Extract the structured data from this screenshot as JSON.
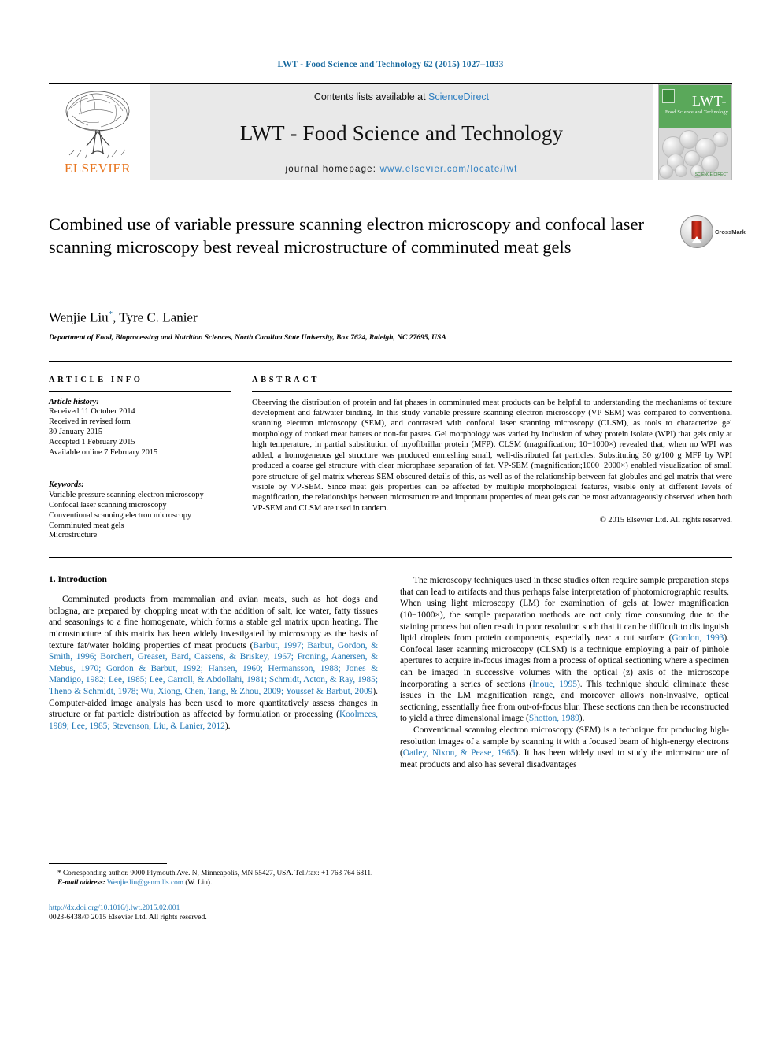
{
  "running_head": "LWT - Food Science and Technology 62 (2015) 1027–1033",
  "masthead": {
    "publisher": "ELSEVIER",
    "contents_prefix": "Contents lists available at ",
    "contents_link": "ScienceDirect",
    "journal_name": "LWT - Food Science and Technology",
    "homepage_prefix": "journal homepage: ",
    "homepage_url": "www.elsevier.com/locate/lwt",
    "cover": {
      "title": "LWT-",
      "subtitle": "Food Science and Technology",
      "footer": "SCIENCE DIRECT"
    }
  },
  "article": {
    "title": "Combined use of variable pressure scanning electron microscopy and confocal laser scanning microscopy best reveal microstructure of comminuted meat gels",
    "crossmark_label": "CrossMark",
    "authors": "Wenjie Liu",
    "author_marker": "*",
    "authors_rest": ", Tyre C. Lanier",
    "affiliation": "Department of Food, Bioprocessing and Nutrition Sciences, North Carolina State University, Box 7624, Raleigh, NC 27695, USA"
  },
  "article_info": {
    "heading": "ARTICLE INFO",
    "history_label": "Article history:",
    "history": [
      "Received 11 October 2014",
      "Received in revised form",
      "30 January 2015",
      "Accepted 1 February 2015",
      "Available online 7 February 2015"
    ],
    "keywords_label": "Keywords:",
    "keywords": [
      "Variable pressure scanning electron microscopy",
      "Confocal laser scanning microscopy",
      "Conventional scanning electron microscopy",
      "Comminuted meat gels",
      "Microstructure"
    ]
  },
  "abstract": {
    "heading": "ABSTRACT",
    "text": "Observing the distribution of protein and fat phases in comminuted meat products can be helpful to understanding the mechanisms of texture development and fat/water binding. In this study variable pressure scanning electron microscopy (VP-SEM) was compared to conventional scanning electron microscopy (SEM), and contrasted with confocal laser scanning microscopy (CLSM), as tools to characterize gel morphology of cooked meat batters or non-fat pastes. Gel morphology was varied by inclusion of whey protein isolate (WPI) that gels only at high temperature, in partial substitution of myofibrillar protein (MFP). CLSM (magnification; 10−1000×) revealed that, when no WPI was added, a homogeneous gel structure was produced enmeshing small, well-distributed fat particles. Substituting 30 g/100 g MFP by WPI produced a coarse gel structure with clear microphase separation of fat. VP-SEM (magnification;1000−2000×) enabled visualization of small pore structure of gel matrix whereas SEM obscured details of this, as well as of the relationship between fat globules and gel matrix that were visible by VP-SEM. Since meat gels properties can be affected by multiple morphological features, visible only at different levels of magnification, the relationships between microstructure and important properties of meat gels can be most advantageously observed when both VP-SEM and CLSM are used in tandem.",
    "copyright": "© 2015 Elsevier Ltd. All rights reserved."
  },
  "introduction": {
    "heading": "1. Introduction",
    "left_p1_a": "Comminuted products from mammalian and avian meats, such as hot dogs and bologna, are prepared by chopping meat with the addition of salt, ice water, fatty tissues and seasonings to a fine homogenate, which forms a stable gel matrix upon heating. The microstructure of this matrix has been widely investigated by microscopy as the basis of texture fat/water holding properties of meat products (",
    "left_p1_cite1": "Barbut, 1997; Barbut, Gordon, & Smith, 1996; Borchert, Greaser, Bard, Cassens, & Briskey, 1967; Froning, Aanersen, & Mebus, 1970; Gordon & Barbut, 1992; Hansen, 1960; Hermansson, 1988; Jones & Mandigo, 1982; Lee, 1985; Lee, Carroll, & Abdollahi, 1981; Schmidt, Acton, & Ray, 1985; Theno & Schmidt, 1978; Wu, Xiong, Chen, Tang, & Zhou, 2009; Youssef & Barbut, 2009",
    "left_p1_b": "). Computer-aided image analysis has been used to more quantitatively assess changes in structure or fat particle distribution as affected by formulation or processing (",
    "left_p1_cite2": "Koolmees, 1989; Lee, 1985; Stevenson, Liu, & Lanier, 2012",
    "left_p1_c": ").",
    "right_p1_a": "The microscopy techniques used in these studies often require sample preparation steps that can lead to artifacts and thus perhaps false interpretation of photomicrographic results. When using light microscopy (LM) for examination of gels at lower magnification (10−1000×), the sample preparation methods are not only time consuming due to the staining process but often result in poor resolution such that it can be difficult to distinguish lipid droplets from protein components, especially near a cut surface (",
    "right_p1_cite1": "Gordon, 1993",
    "right_p1_b": "). Confocal laser scanning microscopy (CLSM) is a technique employing a pair of pinhole apertures to acquire in-focus images from a process of optical sectioning where a specimen can be imaged in successive volumes with the optical (z) axis of the microscope incorporating a series of sections (",
    "right_p1_cite2": "Inoue, 1995",
    "right_p1_c": "). This technique should eliminate these issues in the LM magnification range, and moreover allows non-invasive, optical sectioning, essentially free from out-of-focus blur. These sections can then be reconstructed to yield a three dimensional image (",
    "right_p1_cite3": "Shotton, 1989",
    "right_p1_d": ").",
    "right_p2_a": "Conventional scanning electron microscopy (SEM) is a technique for producing high-resolution images of a sample by scanning it with a focused beam of high-energy electrons (",
    "right_p2_cite1": "Oatley, Nixon, & Pease, 1965",
    "right_p2_b": "). It has been widely used to study the microstructure of meat products and also has several disadvantages"
  },
  "footnotes": {
    "corresponding_marker": "*",
    "corresponding": " Corresponding author. 9000 Plymouth Ave. N, Minneapolis, MN 55427, USA. Tel./fax: +1 763 764 6811.",
    "email_label": "E-mail address:",
    "email": "Wenjie.liu@genmills.com",
    "email_suffix": " (W. Liu).",
    "doi": "http://dx.doi.org/10.1016/j.lwt.2015.02.001",
    "issn": "0023-6438/© 2015 Elsevier Ltd. All rights reserved."
  },
  "colors": {
    "link": "#2077b5",
    "header_blue": "#1a6ba0",
    "elsevier_orange": "#e87722",
    "cover_green": "#5aa85a"
  }
}
